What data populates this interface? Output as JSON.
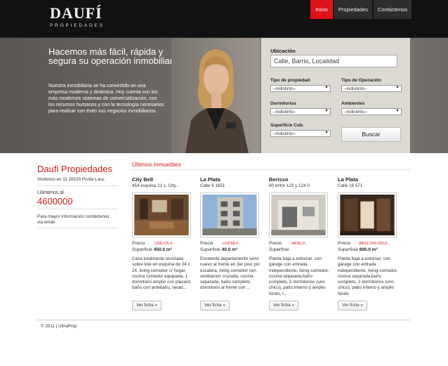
{
  "brand": {
    "logo_main": "DAUFÍ",
    "logo_sub": "PROPIEDADES"
  },
  "nav": [
    "Inicio",
    "Propiedades",
    "Contáctenos"
  ],
  "hero": {
    "title": "Hacemos más fácil, rápida y segura su operación inmobiliaria",
    "text": "Nuestra inmobiliaria se ha convertido en una empresa moderna y dinámica. Hoy cuenta con los más modernos sistemas de comercialización, con los recursos humanos y con la tecnología necesarios para realizar con éxito sus negocios inmobiliarios."
  },
  "search": {
    "ubicacion_label": "Ubicación",
    "ubicacion_value": "Calle, Barrio, Localidad",
    "tipo_propiedad_label": "Tipo de propiedad",
    "tipo_operacion_label": "Tipo de Operación",
    "dormitorios_label": "Dormitorios",
    "ambientes_label": "Ambientes",
    "superficie_label": "Superficie Cub.",
    "select_value": "--indistinto--",
    "button": "Buscar"
  },
  "sidebar": {
    "title": "Daufi Propiedades",
    "address": "Visítenos en 11 28100 Punta Lara.",
    "call": "Llámenos al",
    "phone": "4600000",
    "more": "Para mayor información contáctenos via email"
  },
  "ultimos": {
    "title": "Últimos Inmuebles",
    "price_label": "Precio",
    "surface_label": "Superficie",
    "button": "Ver ficha »",
    "cards": [
      {
        "title": "City Bell",
        "address": "454 esquina 21 c, City...",
        "price": "USD135,0..",
        "surface": "450.0 m²",
        "desc": "Casa totalmente reciclada sobre lote en esquina de 24 x 24, living comedor c/ hogar, cocina comedor equipada, 1 dormitorio amplio con placard, baño con antebaño, lavad..."
      },
      {
        "title": "La Plata",
        "address": "Calle 9 1651",
        "price": "USD58,0..",
        "surface": "40.0 m²",
        "desc": "Excelente departamento semi nuevo al frente en 3er piso por escalera, living comedor con ventilacion cruzada, cocina separada, baño completo, dormitorio al frente con ..."
      },
      {
        "title": "Berisso",
        "address": "60 entre 123 y 124 0",
        "price": "ARS0,0..",
        "surface": "",
        "desc": "Planta baja a extrenar, con garage con entrada independiente, living-comedor, cocina separada,baño completo, 2 dormitorios (uno chico), patio interno y amplio fondo, l..."
      },
      {
        "title": "La Plata",
        "address": "Calle 18 571",
        "price": "ARS1.500.000,0..",
        "surface": "600.0 m²",
        "desc": "Planta baja a extrenar, con garage con entrada independiente, living-comedor, cocina separada,baño completo, 2 dormitorios (uno chico), patio interno y amplio fondo"
      }
    ]
  },
  "footer": "© 2011 | UltraProp",
  "colors": {
    "accent": "#d31a1a",
    "header": "#111111",
    "nav_active": "#e0121a"
  }
}
